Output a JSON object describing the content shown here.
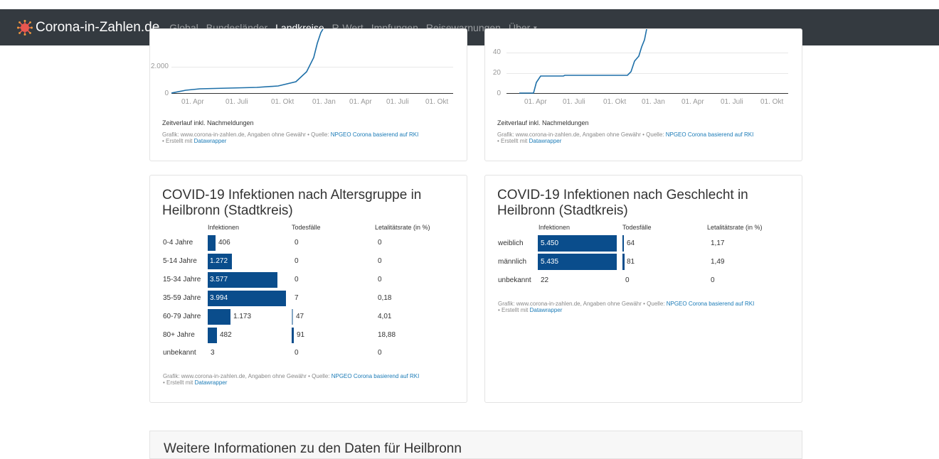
{
  "navbar": {
    "brand": "Corona-in-Zahlen.de",
    "items": [
      {
        "label": "Global",
        "active": false
      },
      {
        "label": "Bundesländer",
        "active": false
      },
      {
        "label": "Landkreise",
        "active": true
      },
      {
        "label": "R-Wert",
        "active": false
      },
      {
        "label": "Impfungen",
        "active": false
      },
      {
        "label": "Reisewarnungen",
        "active": false
      },
      {
        "label": "Über",
        "active": false,
        "dropdown": true
      }
    ]
  },
  "source": {
    "prefix": "Grafik: www.corona-in-zahlen.de, Angaben ohne Gewähr • Quelle: ",
    "link": "NPGEO Corona basierend auf RKI",
    "created_prefix": "• Erstellt mit ",
    "created_link": "Datawrapper"
  },
  "chart_left_top": {
    "caption": "Zeitverlauf inkl. Nachmeldungen",
    "yticks": [
      "2.000",
      "0"
    ],
    "xticks": [
      "01. Apr",
      "01. Juli",
      "01. Okt",
      "01. Jan",
      "01. Apr",
      "01. Juli",
      "01. Okt"
    ]
  },
  "chart_right_top": {
    "caption": "Zeitverlauf inkl. Nachmeldungen",
    "yticks": [
      "40",
      "20",
      "0"
    ],
    "xticks": [
      "01. Apr",
      "01. Juli",
      "01. Okt",
      "01. Jan",
      "01. Apr",
      "01. Juli",
      "01. Okt"
    ]
  },
  "age_card": {
    "title_line1": "COVID-19 Infektionen nach Altersgruppe in",
    "title_line2": "Heilbronn (Stadtkreis)",
    "headers": {
      "infections": "Infektionen",
      "deaths": "Todesfälle",
      "rate": "Letalitätsrate (in %)"
    },
    "rows": [
      {
        "label": "0-4 Jahre",
        "infections": "406",
        "deaths": "0",
        "rate": "0"
      },
      {
        "label": "5-14 Jahre",
        "infections": "1.272",
        "deaths": "0",
        "rate": "0"
      },
      {
        "label": "15-34 Jahre",
        "infections": "3.577",
        "deaths": "0",
        "rate": "0"
      },
      {
        "label": "35-59 Jahre",
        "infections": "3.994",
        "deaths": "7",
        "rate": "0,18"
      },
      {
        "label": "60-79 Jahre",
        "infections": "1.173",
        "deaths": "47",
        "rate": "4,01"
      },
      {
        "label": "80+ Jahre",
        "infections": "482",
        "deaths": "91",
        "rate": "18,88"
      },
      {
        "label": "unbekannt",
        "infections": "3",
        "deaths": "0",
        "rate": "0"
      }
    ]
  },
  "gender_card": {
    "title_line1": "COVID-19 Infektionen nach Geschlecht in",
    "title_line2": "Heilbronn (Stadtkreis)",
    "headers": {
      "infections": "Infektionen",
      "deaths": "Todesfälle",
      "rate": "Letalitätsrate (in %)"
    },
    "rows": [
      {
        "label": "weiblich",
        "infections": "5.450",
        "deaths": "64",
        "rate": "1,17"
      },
      {
        "label": "männlich",
        "infections": "5.435",
        "deaths": "81",
        "rate": "1,49"
      },
      {
        "label": "unbekannt",
        "infections": "22",
        "deaths": "0",
        "rate": "0"
      }
    ]
  },
  "bottom_panel": {
    "title": "Weitere Informationen zu den Daten für Heilbronn"
  },
  "colors": {
    "bar": "#0a4d8c",
    "line": "#1d6fa8",
    "navbar": "#343a40",
    "link": "#1b7bb7"
  }
}
